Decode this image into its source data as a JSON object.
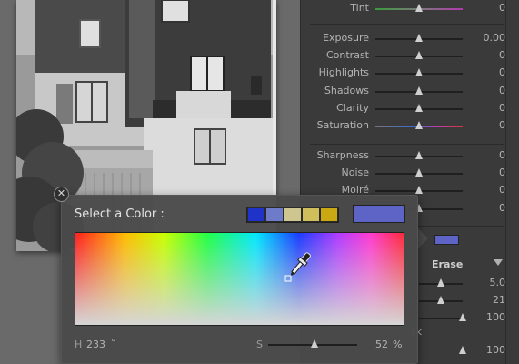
{
  "develop_panel": {
    "sliders": [
      {
        "label": "Tint",
        "value": "0",
        "pos": 0.5,
        "track": "tint"
      },
      {
        "label": "Exposure",
        "value": "0.00",
        "pos": 0.5,
        "track": "plain"
      },
      {
        "label": "Contrast",
        "value": "0",
        "pos": 0.5,
        "track": "plain"
      },
      {
        "label": "Highlights",
        "value": "0",
        "pos": 0.5,
        "track": "plain"
      },
      {
        "label": "Shadows",
        "value": "0",
        "pos": 0.5,
        "track": "plain"
      },
      {
        "label": "Clarity",
        "value": "0",
        "pos": 0.5,
        "track": "plain"
      },
      {
        "label": "Saturation",
        "value": "0",
        "pos": 0.5,
        "track": "saturation"
      },
      {
        "label": "Sharpness",
        "value": "0",
        "pos": 0.5,
        "track": "plain"
      },
      {
        "label": "Noise",
        "value": "0",
        "pos": 0.5,
        "track": "plain"
      },
      {
        "label": "Moiré",
        "value": "0",
        "pos": 0.5,
        "track": "plain"
      },
      {
        "label": "",
        "value": "0",
        "pos": 0.5,
        "track": "plain"
      }
    ],
    "brush": {
      "erase_label": "Erase",
      "values": [
        "5.0",
        "21",
        "100"
      ],
      "value_positions": [
        0.5,
        0.5,
        1.0
      ],
      "mask_label_fragment": "sk",
      "bottom_value": "100"
    },
    "effect_color": "#5d64c6"
  },
  "color_picker": {
    "title": "Select a Color :",
    "close_glyph": "✕",
    "presets": [
      "#1f33c9",
      "#6d7bc9",
      "#cfc68f",
      "#cfbe5a",
      "#c9a814"
    ],
    "current_color": "#5d64c6",
    "hue_label": "H",
    "hue_value": "233",
    "hue_unit": "°",
    "saturation_label": "S",
    "saturation_value": "52",
    "saturation_unit": "%",
    "saturation_pos": 0.52
  }
}
